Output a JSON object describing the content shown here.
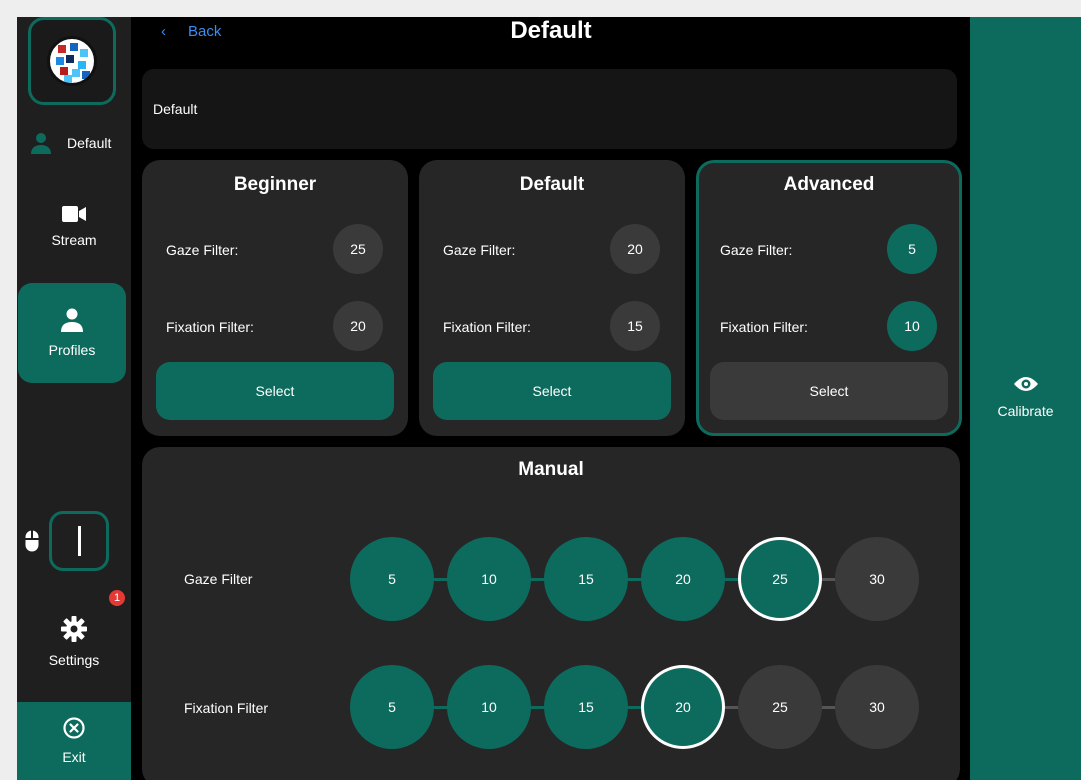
{
  "sidebar": {
    "profile_name": "Default",
    "items": [
      {
        "label": "Stream",
        "icon": "video-camera-icon"
      },
      {
        "label": "Profiles",
        "icon": "person-icon"
      },
      {
        "label": "Settings",
        "icon": "gear-icon"
      },
      {
        "label": "Exit",
        "icon": "close-circle-icon"
      }
    ],
    "settings_badge": "1"
  },
  "header": {
    "back_label": "Back",
    "title": "Default"
  },
  "profile_name_field": {
    "value": "Default"
  },
  "presets": [
    {
      "title": "Beginner",
      "gaze_label": "Gaze Filter:",
      "gaze_value": "25",
      "fixation_label": "Fixation Filter:",
      "fixation_value": "20",
      "button_label": "Select"
    },
    {
      "title": "Default",
      "gaze_label": "Gaze Filter:",
      "gaze_value": "20",
      "fixation_label": "Fixation Filter:",
      "fixation_value": "15",
      "button_label": "Select"
    },
    {
      "title": "Advanced",
      "gaze_label": "Gaze Filter:",
      "gaze_value": "5",
      "fixation_label": "Fixation Filter:",
      "fixation_value": "10",
      "button_label": "Select"
    }
  ],
  "manual": {
    "title": "Manual",
    "gaze": {
      "label": "Gaze Filter",
      "options": [
        "5",
        "10",
        "15",
        "20",
        "25",
        "30"
      ],
      "selected": "25"
    },
    "fixation": {
      "label": "Fixation Filter",
      "options": [
        "5",
        "10",
        "15",
        "20",
        "25",
        "30"
      ],
      "selected": "20"
    }
  },
  "calibrate": {
    "label": "Calibrate",
    "icon": "eye-icon"
  },
  "colors": {
    "accent": "#0d6b5e",
    "card": "#262626",
    "link": "#3b8df0",
    "badge": "#e53935"
  }
}
